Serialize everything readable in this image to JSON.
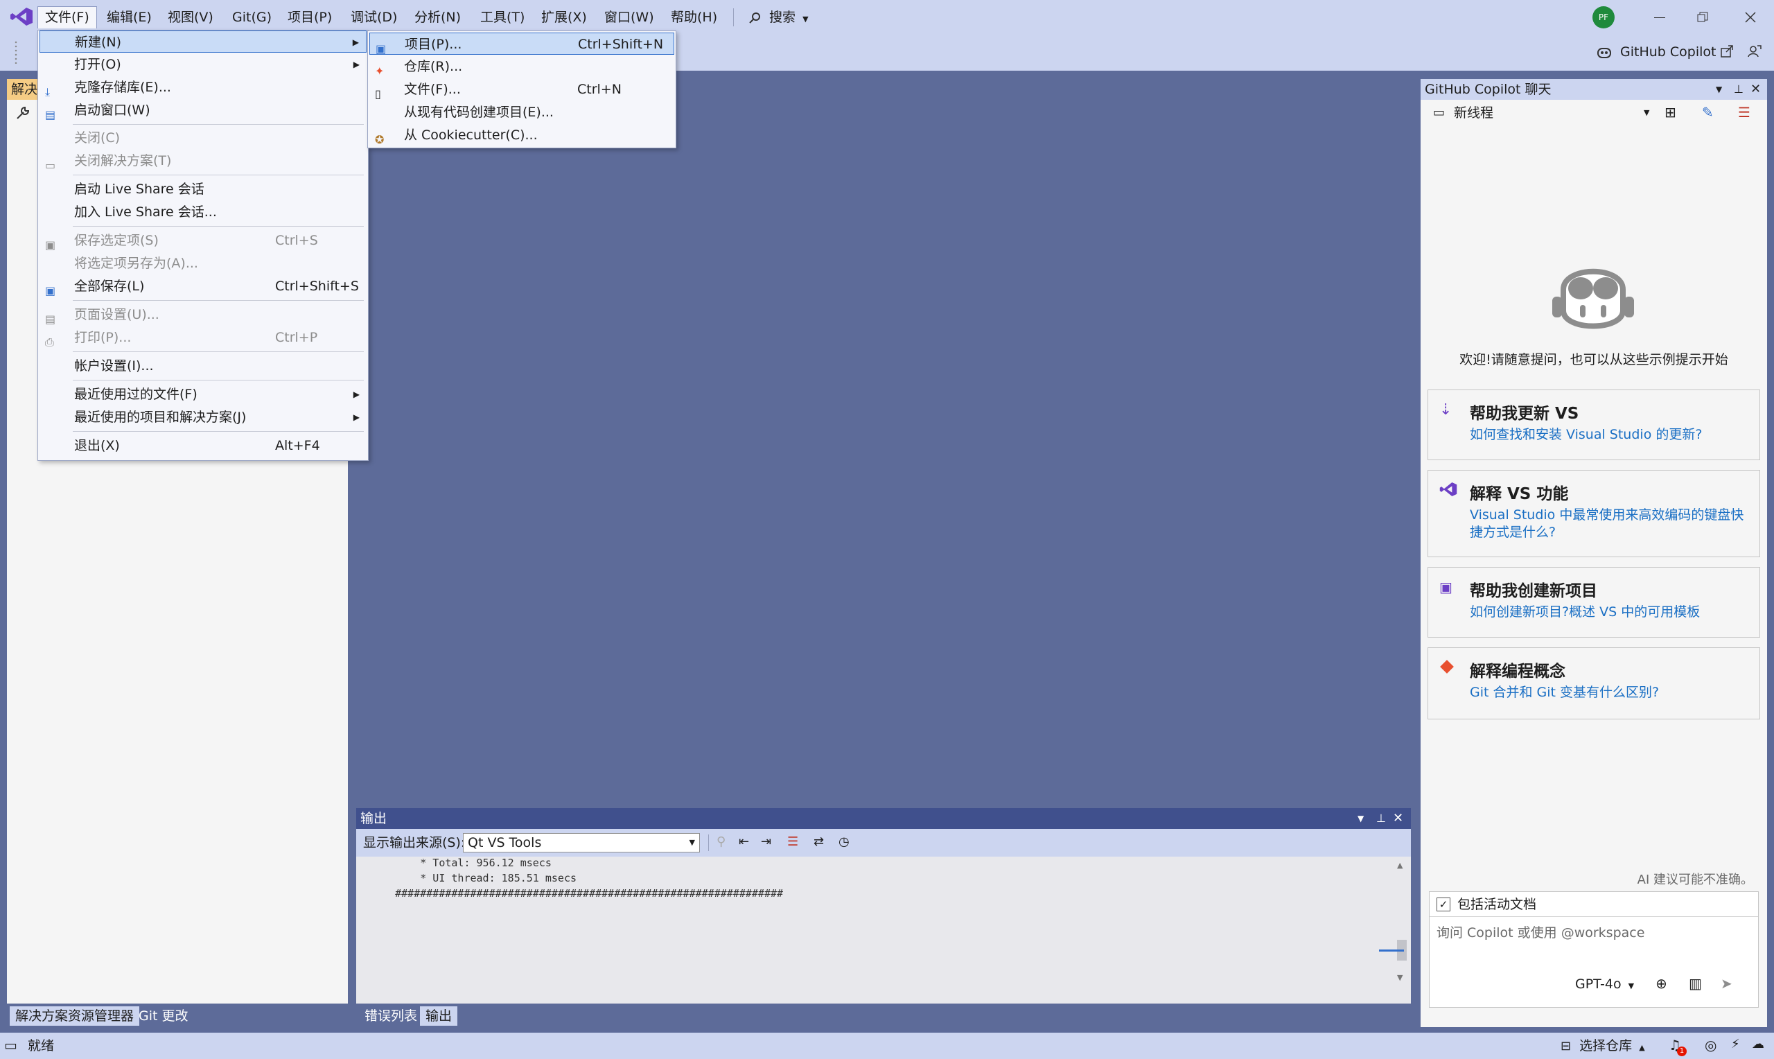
{
  "menubar": {
    "items": [
      "文件(F)",
      "编辑(E)",
      "视图(V)",
      "Git(G)",
      "项目(P)",
      "调试(D)",
      "分析(N)",
      "工具(T)",
      "扩展(X)",
      "窗口(W)",
      "帮助(H)"
    ],
    "search_label": "搜索",
    "avatar_initials": "PF"
  },
  "toolbar": {
    "copilot_label": "GitHub Copilot"
  },
  "file_menu": {
    "new": "新建(N)",
    "open": "打开(O)",
    "clone": "克隆存储库(E)...",
    "start_window": "启动窗口(W)",
    "close": "关闭(C)",
    "close_solution": "关闭解决方案(T)",
    "live_share_start": "启动 Live Share 会话",
    "live_share_join": "加入 Live Share 会话...",
    "save_selected": "保存选定项(S)",
    "save_selected_sc": "Ctrl+S",
    "save_as": "将选定项另存为(A)...",
    "save_all": "全部保存(L)",
    "save_all_sc": "Ctrl+Shift+S",
    "page_setup": "页面设置(U)...",
    "print": "打印(P)...",
    "print_sc": "Ctrl+P",
    "account": "帐户设置(I)...",
    "recent_files": "最近使用过的文件(F)",
    "recent_projects": "最近使用的项目和解决方案(J)",
    "exit": "退出(X)",
    "exit_sc": "Alt+F4"
  },
  "new_submenu": {
    "project": "项目(P)...",
    "project_sc": "Ctrl+Shift+N",
    "repo": "仓库(R)...",
    "file": "文件(F)...",
    "file_sc": "Ctrl+N",
    "from_code": "从现有代码创建项目(E)...",
    "cookiecutter": "从 Cookiecutter(C)..."
  },
  "left_panel": {
    "header_partial": "解决",
    "tabs": [
      "解决方案资源管理器",
      "Git 更改"
    ]
  },
  "output": {
    "title": "输出",
    "source_label": "显示输出来源(S):",
    "source_value": "Qt VS Tools",
    "lines": [
      "        * Total: 956.12 msecs",
      "        * UI thread: 185.51 msecs",
      "    ##############################################################"
    ],
    "tabs": [
      "错误列表",
      "输出"
    ]
  },
  "copilot": {
    "title": "GitHub Copilot 聊天",
    "thread": "新线程",
    "welcome": "欢迎!请随意提问，也可以从这些示例提示开始",
    "cards": [
      {
        "title": "帮助我更新 VS",
        "sub": "如何查找和安装 Visual Studio 的更新?"
      },
      {
        "title": "解释 VS 功能",
        "sub": "Visual Studio 中最常使用来高效编码的键盘快捷方式是什么?"
      },
      {
        "title": "帮助我创建新项目",
        "sub": "如何创建新项目?概述 VS 中的可用模板"
      },
      {
        "title": "解释编程概念",
        "sub": "Git 合并和 Git 变基有什么区别?"
      }
    ],
    "disclaimer": "AI 建议可能不准确。",
    "include_doc": "包括活动文档",
    "input_placeholder": "询问 Copilot 或使用 @workspace",
    "model": "GPT-4o"
  },
  "status": {
    "ready": "就绪",
    "repo": "选择仓库",
    "notif_count": "1"
  },
  "colors": {
    "accent": "#3370cc",
    "link": "#1a6fc4",
    "vs_purple": "#6c3fc5"
  }
}
